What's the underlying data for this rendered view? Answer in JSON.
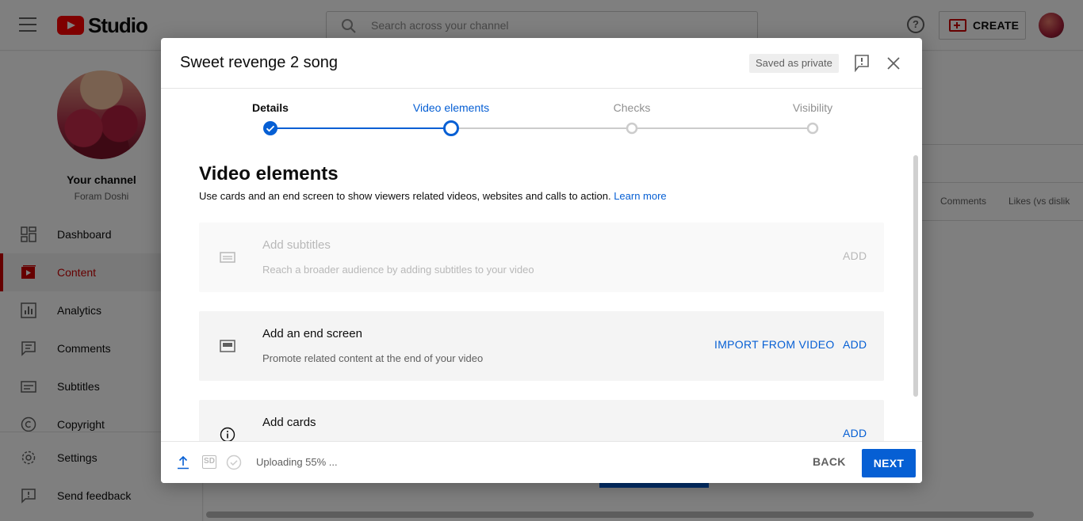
{
  "app": {
    "logo_text": "Studio",
    "search_placeholder": "Search across your channel",
    "help_glyph": "?",
    "create_label": "CREATE"
  },
  "sidebar": {
    "channel_title": "Your channel",
    "channel_name": "Foram Doshi",
    "items": [
      {
        "label": "Dashboard",
        "icon": "dashboard-icon"
      },
      {
        "label": "Content",
        "icon": "content-icon",
        "active": true
      },
      {
        "label": "Analytics",
        "icon": "analytics-icon"
      },
      {
        "label": "Comments",
        "icon": "comments-icon"
      },
      {
        "label": "Subtitles",
        "icon": "subtitles-icon"
      },
      {
        "label": "Copyright",
        "icon": "copyright-icon"
      },
      {
        "label": "Settings",
        "icon": "gear-icon"
      },
      {
        "label": "Send feedback",
        "icon": "feedback-icon"
      }
    ]
  },
  "background": {
    "col_comments": "Comments",
    "col_likes": "Likes (vs dislik"
  },
  "dialog": {
    "title": "Sweet revenge 2 song",
    "saved_badge": "Saved as private",
    "steps": [
      {
        "label": "Details",
        "state": "done"
      },
      {
        "label": "Video elements",
        "state": "current"
      },
      {
        "label": "Checks",
        "state": "pending"
      },
      {
        "label": "Visibility",
        "state": "pending"
      }
    ],
    "section_title": "Video elements",
    "section_desc": "Use cards and an end screen to show viewers related videos, websites and calls to action.",
    "learn_more": "Learn more",
    "cards": [
      {
        "title": "Add subtitles",
        "desc": "Reach a broader audience by adding subtitles to your video",
        "add": "ADD",
        "disabled": true
      },
      {
        "title": "Add an end screen",
        "desc": "Promote related content at the end of your video",
        "import": "IMPORT FROM VIDEO",
        "add": "ADD"
      },
      {
        "title": "Add cards",
        "add": "ADD"
      }
    ],
    "footer": {
      "sd_label": "SD",
      "status": "Uploading 55% ...",
      "upload_progress": 0.55,
      "back": "BACK",
      "next": "NEXT"
    }
  },
  "colors": {
    "accent": "#065fd4",
    "brand_red": "#ff0000",
    "active_nav": "#cc0000"
  }
}
